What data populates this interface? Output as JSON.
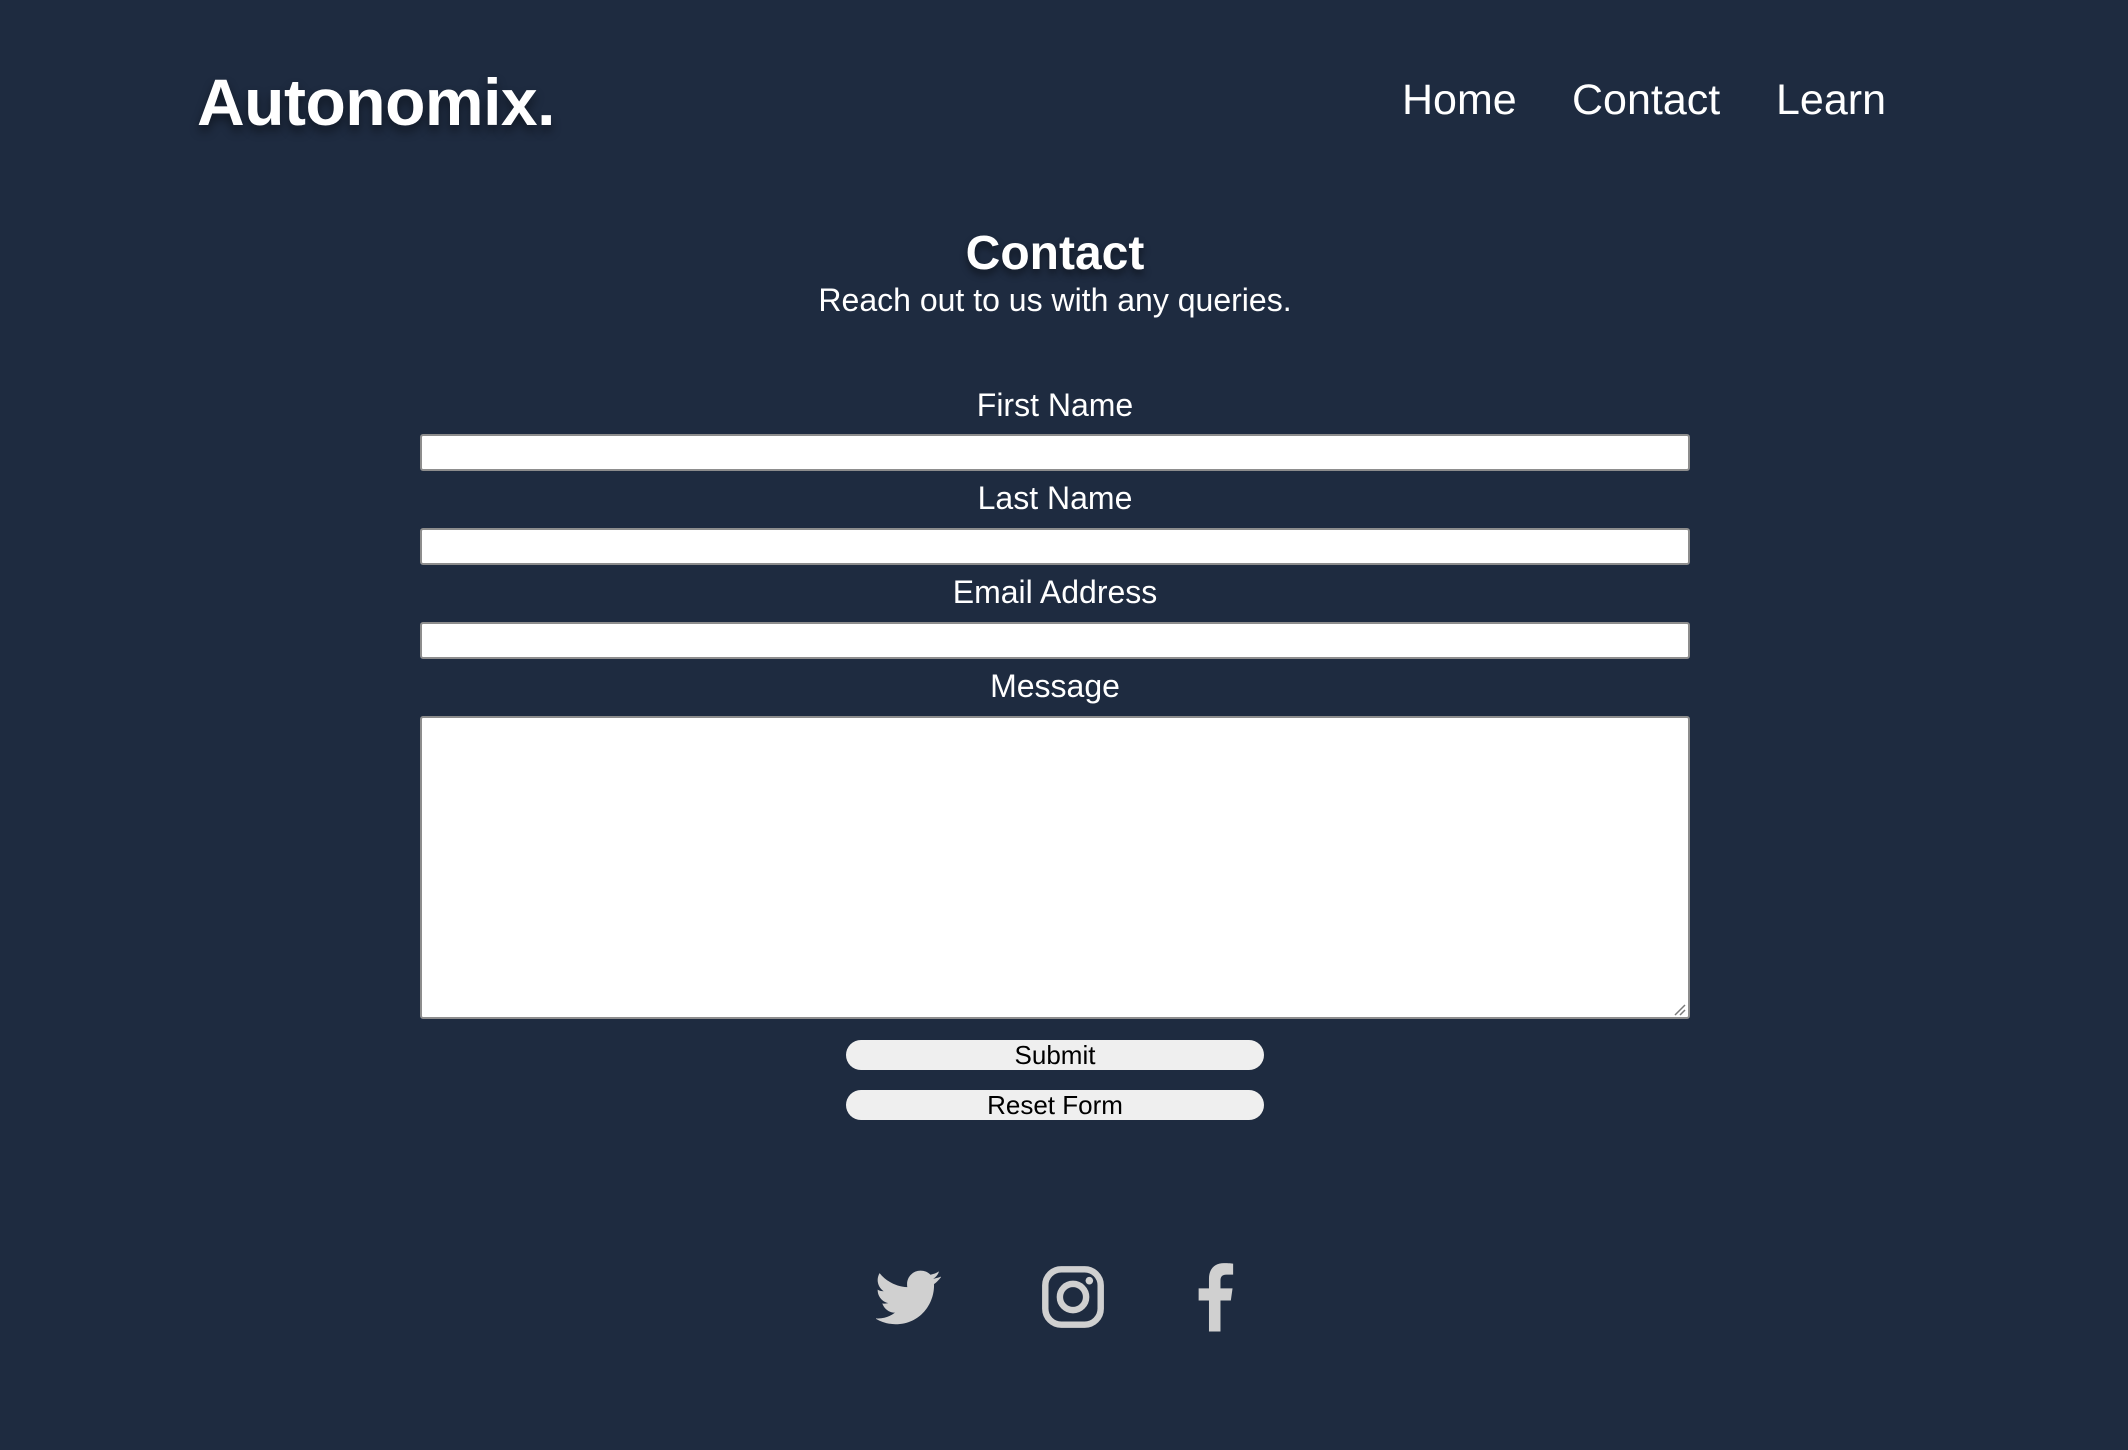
{
  "header": {
    "logo": "Autonomix.",
    "nav": [
      {
        "label": "Home"
      },
      {
        "label": "Contact"
      },
      {
        "label": "Learn"
      }
    ]
  },
  "main": {
    "title": "Contact",
    "subtitle": "Reach out to us with any queries.",
    "form": {
      "first_name_label": "First Name",
      "first_name_value": "",
      "last_name_label": "Last Name",
      "last_name_value": "",
      "email_label": "Email Address",
      "email_value": "",
      "message_label": "Message",
      "message_value": "",
      "submit_label": "Submit",
      "reset_label": "Reset Form"
    }
  },
  "footer": {
    "social_icons": [
      "twitter-icon",
      "instagram-icon",
      "facebook-icon"
    ]
  },
  "colors": {
    "background": "#1e2b40",
    "text": "#ffffff",
    "button_bg": "#efefef",
    "icon": "#d0d0d0"
  }
}
